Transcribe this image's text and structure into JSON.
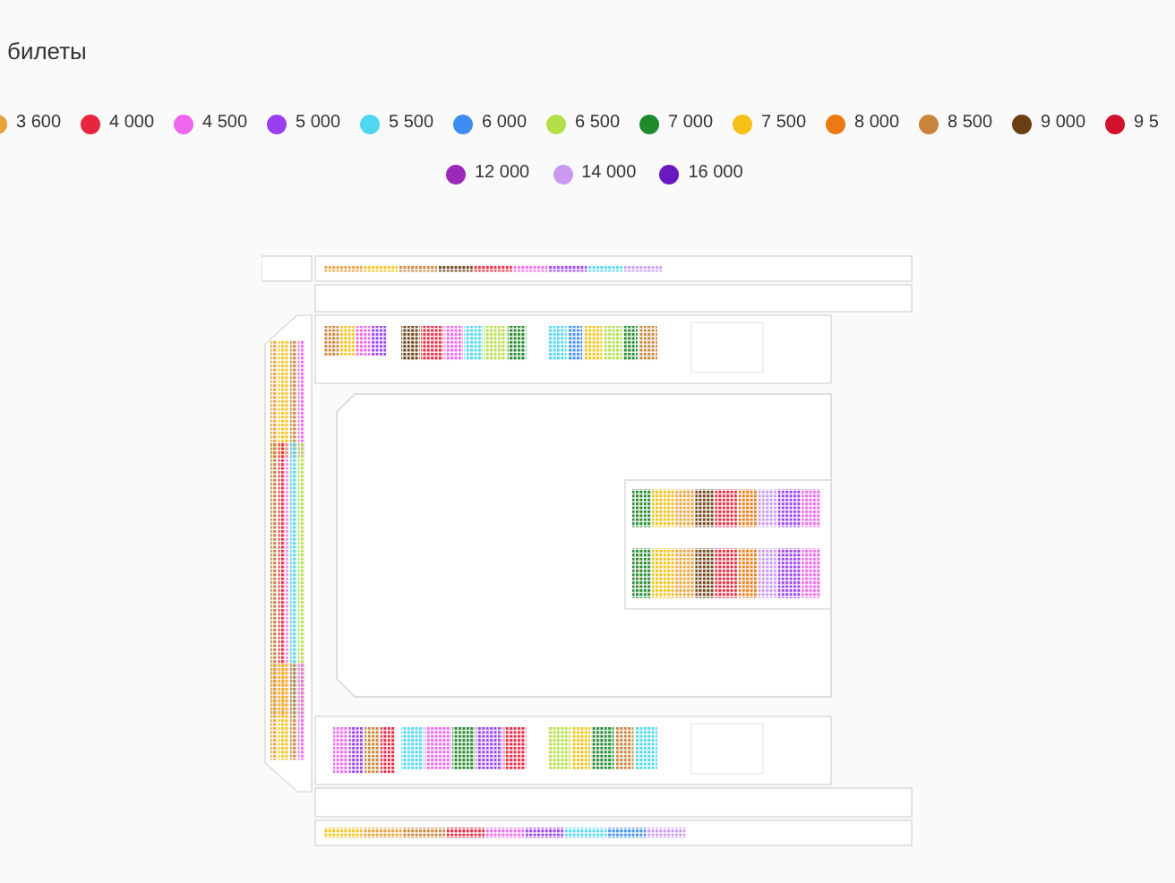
{
  "title": "билеты",
  "legend": [
    {
      "label": "3 600",
      "color": "#e9a13a"
    },
    {
      "label": "4 000",
      "color": "#e8253f"
    },
    {
      "label": "4 500",
      "color": "#ee66ee"
    },
    {
      "label": "5 000",
      "color": "#9a3ff0"
    },
    {
      "label": "5 500",
      "color": "#4fd6f0"
    },
    {
      "label": "6 000",
      "color": "#3d8ef0"
    },
    {
      "label": "6 500",
      "color": "#b3e04a"
    },
    {
      "label": "7 000",
      "color": "#1f8a2a"
    },
    {
      "label": "7 500",
      "color": "#f5c118"
    },
    {
      "label": "8 000",
      "color": "#ec7a12"
    },
    {
      "label": "8 500",
      "color": "#c8843a"
    },
    {
      "label": "9 000",
      "color": "#6b3e14"
    },
    {
      "label": "9 5",
      "color": "#d0122c"
    },
    {
      "label": "12 000",
      "color": "#9b2ab8"
    },
    {
      "label": "14 000",
      "color": "#c99af0"
    },
    {
      "label": "16 000",
      "color": "#6a18c0"
    }
  ]
}
